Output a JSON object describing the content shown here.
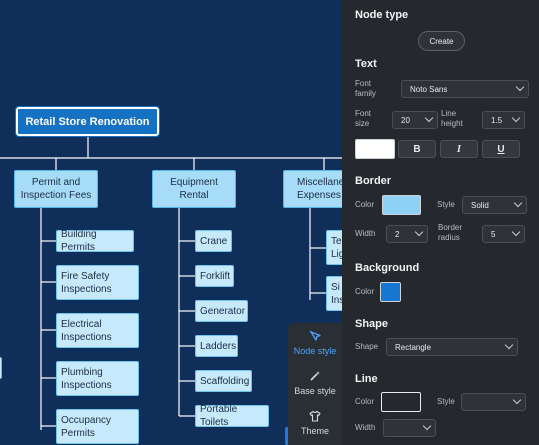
{
  "mindmap": {
    "root": "Retail Store Renovation",
    "branches": [
      {
        "label": "Permit and\nInspection Fees",
        "children": [
          "Building Permits",
          "Fire Safety\nInspections",
          "Electrical\nInspections",
          "Plumbing\nInspections",
          "Occupancy\nPermits"
        ]
      },
      {
        "label": "Equipment\nRental",
        "children": [
          "Crane",
          "Forklift",
          "Generator",
          "Ladders",
          "Scaffolding",
          "Portable Toilets"
        ]
      },
      {
        "label": "Miscellaneo\nExpenses",
        "children": [
          "Te\nLig",
          "Si\nIns"
        ]
      }
    ]
  },
  "toolbar": {
    "tools": [
      {
        "label": "Node style",
        "icon": "node-style-icon",
        "active": true
      },
      {
        "label": "Base style",
        "icon": "base-style-icon",
        "active": false
      },
      {
        "label": "Theme",
        "icon": "theme-icon",
        "active": false
      }
    ]
  },
  "panel": {
    "node_type": {
      "title": "Node type",
      "create_label": "Create"
    },
    "text": {
      "title": "Text",
      "font_family_label": "Font\nfamily",
      "font_family_value": "Noto Sans",
      "font_size_label": "Font\nsize",
      "font_size_value": "20",
      "line_height_label": "Line\nheight",
      "line_height_value": "1.5",
      "bold_label": "B",
      "italic_label": "I",
      "underline_label": "U",
      "text_color": "#ffffff"
    },
    "border": {
      "title": "Border",
      "color_label": "Color",
      "color_value": "#8fd1f5",
      "style_label": "Style",
      "style_value": "Solid",
      "width_label": "Width",
      "width_value": "2",
      "radius_label": "Border\nradius",
      "radius_value": "5"
    },
    "background": {
      "title": "Background",
      "color_label": "Color",
      "color_value": "#1677d2"
    },
    "shape": {
      "title": "Shape",
      "shape_label": "Shape",
      "shape_value": "Rectangle"
    },
    "line": {
      "title": "Line",
      "color_label": "Color",
      "color_value": "#25292e",
      "style_label": "Style",
      "style_value": "",
      "width_label": "Width",
      "width_value": ""
    }
  }
}
